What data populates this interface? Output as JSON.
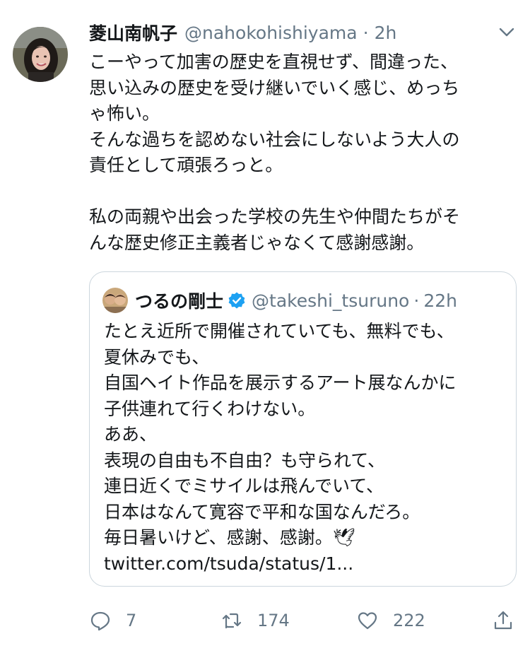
{
  "tweet": {
    "display_name": "菱山南帆子",
    "handle": "@nahokohishiyama",
    "separator": "·",
    "time": "2h",
    "text": "こーやって加害の歴史を直視せず、間違った、\n思い込みの歴史を受け継いでいく感じ、めっち\nゃ怖い。\nそんな過ちを認めない社会にしないよう大人の\n責任として頑張ろっと。\n\n私の両親や出会った学校の先生や仲間たちがそ\nんな歴史修正主義者じゃなくて感謝感謝。"
  },
  "quoted_tweet": {
    "display_name": "つるの剛士",
    "handle": "@takeshi_tsuruno",
    "separator": "·",
    "time": "22h",
    "text": "たとえ近所で開催されていても、無料でも、\n夏休みでも、\n自国ヘイト作品を展示するアート展なんかに\n子供連れて行くわけない。\nああ、\n表現の自由も不自由？も守られて、\n連日近くでミサイルは飛んでいて、\n日本はなんて寛容で平和な国なんだろ。\n毎日暑いけど、感謝、感謝。🕊\ntwitter.com/tsuda/status/1..."
  },
  "actions": {
    "reply_count": "7",
    "retweet_count": "174",
    "like_count": "222"
  },
  "icons": {
    "caret": "chevron-down-icon",
    "verified": "verified-badge-icon",
    "reply": "reply-icon",
    "retweet": "retweet-icon",
    "like": "heart-icon",
    "share": "share-icon"
  },
  "colors": {
    "text": "#14171a",
    "secondary": "#657786",
    "border": "#ccd6dd",
    "verified": "#1da1f2"
  }
}
